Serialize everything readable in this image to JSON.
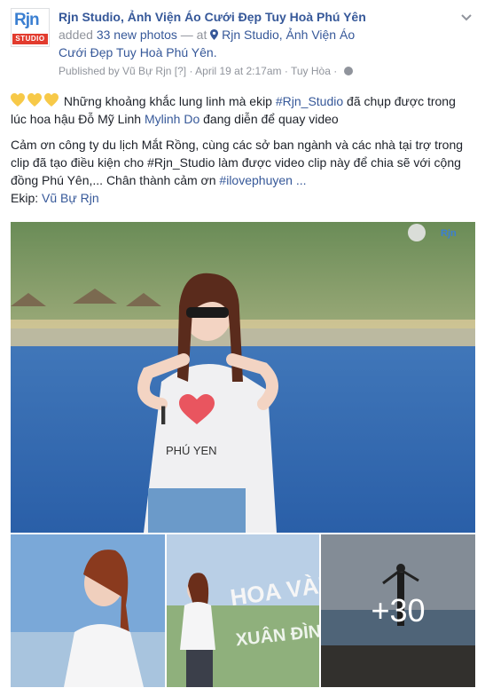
{
  "post": {
    "page_name": "Rjn Studio, Ảnh Viện Áo Cưới Đẹp Tuy Hoà Phú Yên",
    "avatar_logo_top": "Rjn",
    "avatar_logo_bottom": "STUDIO",
    "action_prefix": "added ",
    "action_photos": "33 new photos",
    "action_at": " — at ",
    "location_line1": "Rjn Studio, Ảnh Viện Áo",
    "location_line2": "Cưới Đẹp Tuy Hoà Phú Yên.",
    "published_by": "Published by Vũ Bự Rjn",
    "published_marker": "[?]",
    "date": "April 19 at 2:17am",
    "place": "Tuy Hòa",
    "separator": "·"
  },
  "content": {
    "p1_a": " Những khoảng khắc lung linh mà ekip ",
    "p1_hashtag": "#Rjn_Studio",
    "p1_b": " đã chụp được trong lúc hoa hậu Đỗ Mỹ Linh ",
    "p1_mention": "Mylinh Do",
    "p1_c": " đang diễn để quay video",
    "p2_a": "Cảm ơn công ty du lịch Mắt Rồng, cùng các sở ban ngành và các nhà tại trợ trong clip đã tạo điều kiện cho #Rjn_Studio làm được video clip này để chia sẽ với cộng đồng Phú Yên,... Chân thành cảm ơn ",
    "p2_hashtag": "#ilovephuyen",
    "p2_more": " ...",
    "p3_label": "Ekip: ",
    "p3_mention": "Vũ Bự Rjn"
  },
  "photos": {
    "more_count": "+30",
    "shirt_text": "PHÚ YEN",
    "watermark": "Rjn",
    "sign_text": "HOA VÀN",
    "sign_text2": "XUÂN ĐÌNH"
  },
  "colors": {
    "link": "#365899",
    "meta": "#90949c",
    "heart": "#f7c948"
  }
}
